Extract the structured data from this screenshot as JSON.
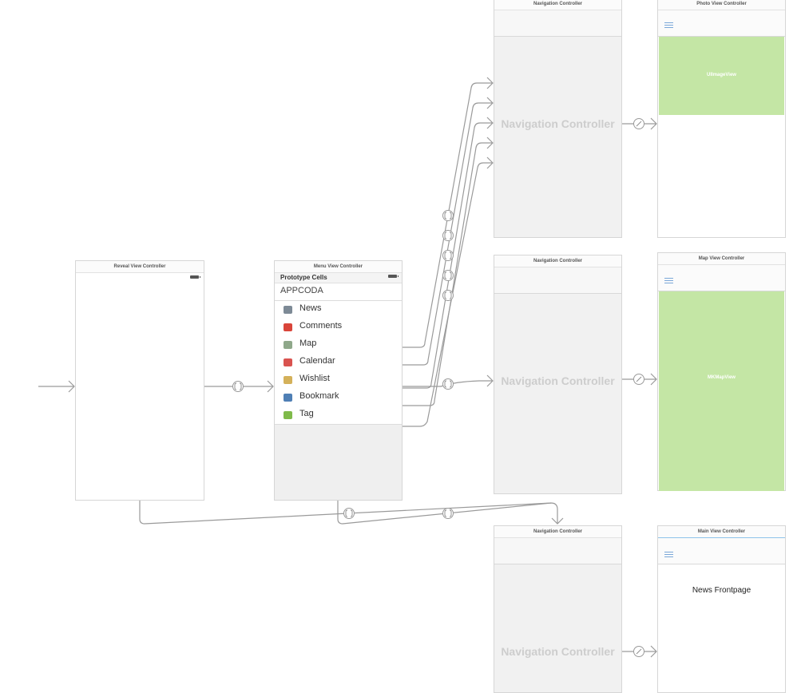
{
  "scenes": {
    "reveal": {
      "title": "Reveal View Controller"
    },
    "menu": {
      "title": "Menu View Controller",
      "prototype_label": "Prototype Cells",
      "header": "APPCODA",
      "items": [
        {
          "label": "News",
          "icon": "news-icon",
          "color": "#7d8a96"
        },
        {
          "label": "Comments",
          "icon": "comments-icon",
          "color": "#d9453a"
        },
        {
          "label": "Map",
          "icon": "map-icon",
          "color": "#8fa88a"
        },
        {
          "label": "Calendar",
          "icon": "calendar-icon",
          "color": "#d9534f"
        },
        {
          "label": "Wishlist",
          "icon": "wishlist-icon",
          "color": "#d4b15a"
        },
        {
          "label": "Bookmark",
          "icon": "bookmark-icon",
          "color": "#4f7fb5"
        },
        {
          "label": "Tag",
          "icon": "tag-icon",
          "color": "#7fba4a"
        }
      ]
    },
    "nav_top": {
      "title": "Navigation Controller",
      "label": "Navigation Controller"
    },
    "nav_mid": {
      "title": "Navigation Controller",
      "label": "Navigation Controller"
    },
    "nav_bottom": {
      "title": "Navigation Controller",
      "label": "Navigation Controller"
    },
    "photo": {
      "title": "Photo View Controller",
      "content_label": "UIImageView"
    },
    "map": {
      "title": "Map View Controller",
      "content_label": "MKMapView"
    },
    "main": {
      "title": "Main View Controller",
      "content_label": "News Frontpage"
    }
  },
  "colors": {
    "segue_line": "#9a9a9a",
    "content_green": "#c4e6a5",
    "nav_label": "#cdcdcd",
    "hamburger": "#7aa7d8"
  }
}
